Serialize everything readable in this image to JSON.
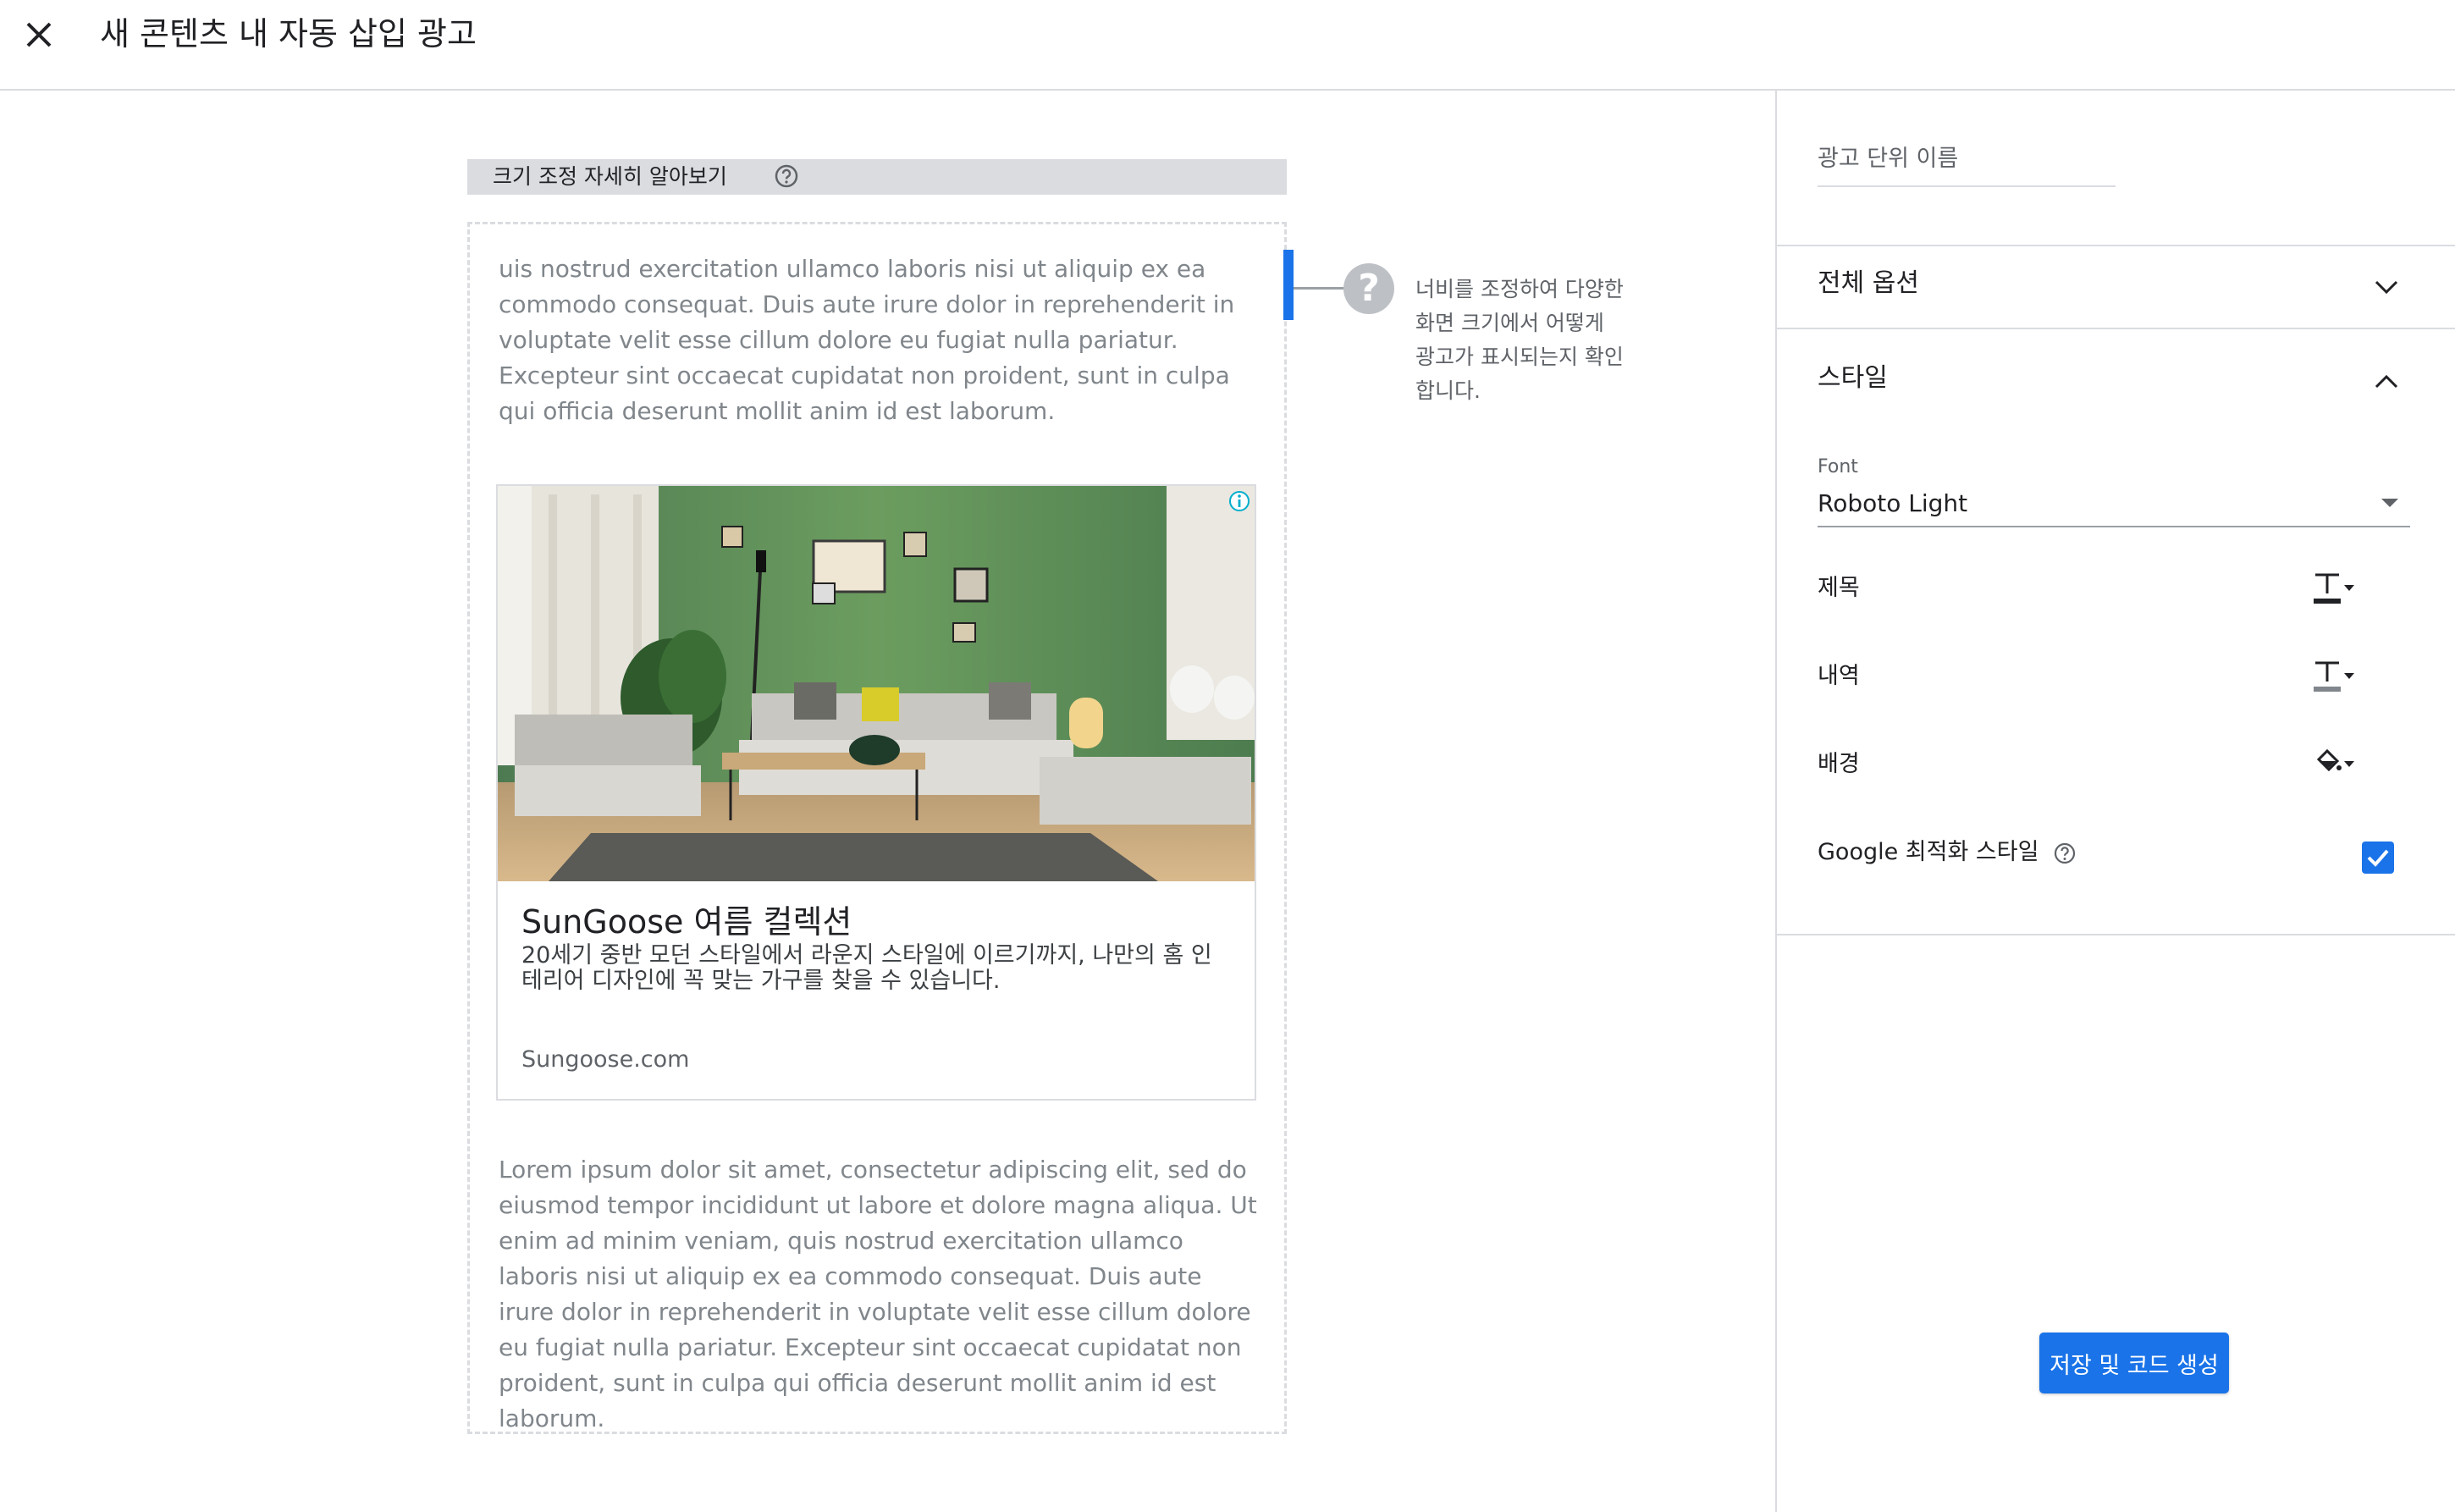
{
  "header": {
    "title": "새 콘텐츠 내 자동 삽입 광고",
    "close_icon": "close-icon"
  },
  "preview": {
    "learn_more_label": "크기 조정 자세히 알아보기",
    "lorem_top": "uis nostrud exercitation ullamco laboris nisi ut aliquip ex ea commodo consequat. Duis aute irure dolor in reprehenderit in voluptate velit esse cillum dolore eu fugiat nulla pariatur. Excepteur sint occaecat cupidatat non proident, sunt in culpa qui officia deserunt mollit anim id est laborum.",
    "lorem_bottom": "Lorem ipsum dolor sit amet, consectetur adipiscing elit, sed do eiusmod tempor incididunt ut labore et dolore magna aliqua. Ut enim ad minim veniam, quis nostrud exercitation ullamco laboris nisi ut aliquip ex ea commodo consequat. Duis aute irure dolor in reprehenderit in voluptate velit esse cillum dolore eu fugiat nulla pariatur. Excepteur sint occaecat cupidatat non proident, sunt in culpa qui officia deserunt mollit anim id est laborum.",
    "resize_hint": "너비를 조정하여 다양한 화면 크기에서 어떻게 광고가 표시되는지 확인합니다.",
    "ad": {
      "headline": "SunGoose 여름 컬렉션",
      "description": "20세기 중반 모던 스타일에서 라운지 스타일에 이르기까지, 나만의 홈 인테리어 디자인에 꼭 맞는 가구를 찾을 수 있습니다.",
      "url": "Sungoose.com"
    }
  },
  "panel": {
    "ad_unit_name_placeholder": "광고 단위 이름",
    "general_options_label": "전체 옵션",
    "style_label": "스타일",
    "font_label": "Font",
    "font_value": "Roboto Light",
    "title_label": "제목",
    "description_label": "내역",
    "background_label": "배경",
    "google_optimized_label": "Google 최적화 스타일",
    "google_optimized_checked": true,
    "save_button_label": "저장 및 코드 생성"
  },
  "colors": {
    "accent": "#1a73e8",
    "divider": "#dadce0",
    "muted_text": "#80868b"
  }
}
